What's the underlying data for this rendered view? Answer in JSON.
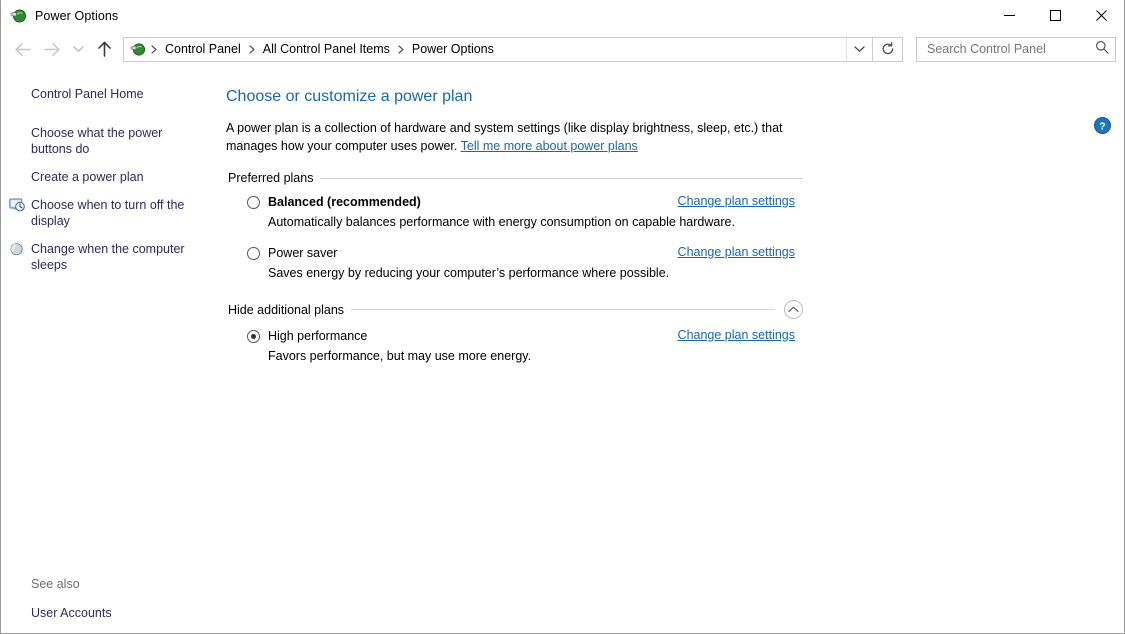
{
  "window": {
    "title": "Power Options",
    "icon": "power-plug-icon",
    "controls": {
      "minimize": "minimize-icon",
      "maximize": "maximize-icon",
      "close": "close-icon"
    }
  },
  "navbar": {
    "back": "back-arrow-icon",
    "forward": "forward-arrow-icon",
    "recent": "recent-locations-chevron-icon",
    "up": "up-arrow-icon",
    "breadcrumbs": [
      "Control Panel",
      "All Control Panel Items",
      "Power Options"
    ],
    "dropdown": "chevron-down-icon",
    "refresh": "refresh-icon",
    "search": {
      "placeholder": "Search Control Panel",
      "value": "",
      "icon": "search-icon"
    }
  },
  "sidebar": {
    "home": "Control Panel Home",
    "items": [
      {
        "label": "Choose what the power buttons do",
        "icon": null
      },
      {
        "label": "Create a power plan",
        "icon": null
      },
      {
        "label": "Choose when to turn off the display",
        "icon": "display-clock-icon"
      },
      {
        "label": "Change when the computer sleeps",
        "icon": "moon-sleep-icon"
      }
    ],
    "see_also": {
      "label": "See also",
      "links": [
        "User Accounts"
      ]
    }
  },
  "content": {
    "help_button": "help-icon",
    "title": "Choose or customize a power plan",
    "intro_part1": "A power plan is a collection of hardware and system settings (like display brightness, sleep, etc.) that manages how your computer uses power. ",
    "intro_link": "Tell me more about power plans",
    "sections": [
      {
        "heading": "Preferred plans",
        "collapse_icon": null,
        "plans": [
          {
            "name": "Balanced (recommended)",
            "bold": true,
            "selected": false,
            "description": "Automatically balances performance with energy consumption on capable hardware.",
            "link": "Change plan settings"
          },
          {
            "name": "Power saver",
            "bold": false,
            "selected": false,
            "description": "Saves energy by reducing your computer’s performance where possible.",
            "link": "Change plan settings"
          }
        ]
      },
      {
        "heading": "Hide additional plans",
        "collapse_icon": "chevron-up-circle-icon",
        "plans": [
          {
            "name": "High performance",
            "bold": false,
            "selected": true,
            "description": "Favors performance, but may use more energy.",
            "link": "Change plan settings"
          }
        ]
      }
    ]
  },
  "colors": {
    "link": "#1767b0",
    "title": "#1767b0",
    "sidebar_link": "#2b2b5e",
    "help_blue": "#1b76bd",
    "rule": "#d4d4d4"
  }
}
